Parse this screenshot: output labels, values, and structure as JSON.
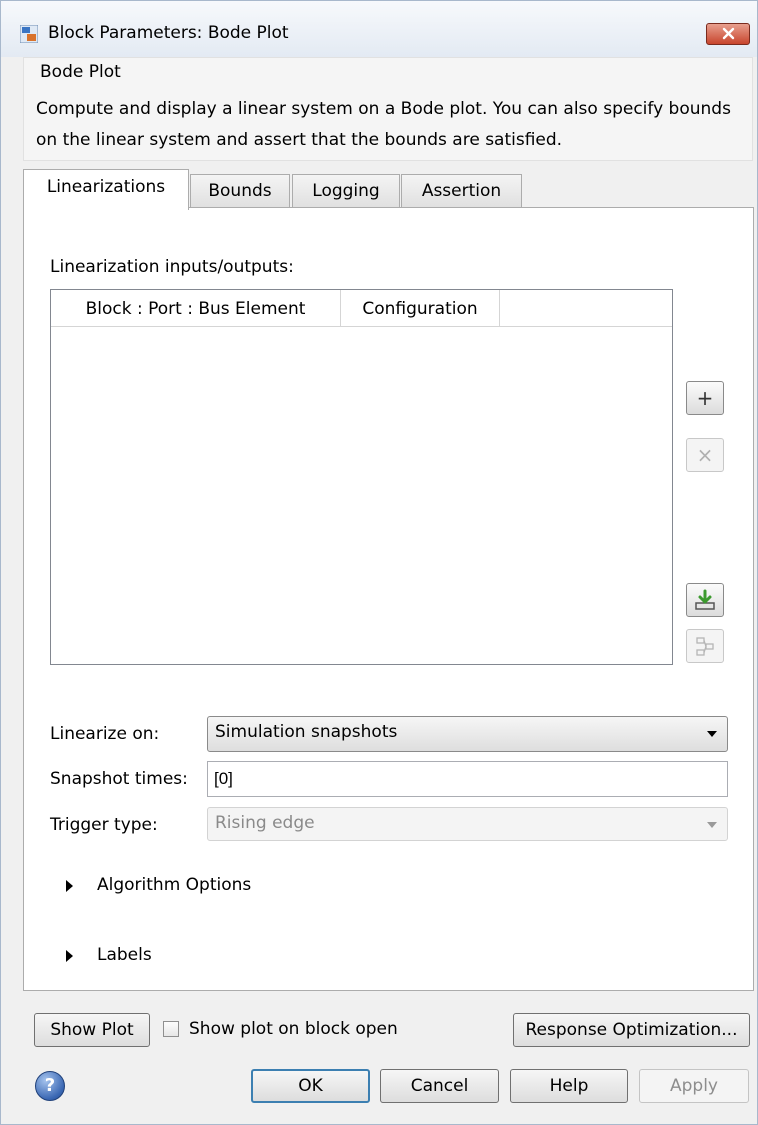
{
  "window": {
    "title": "Block Parameters: Bode Plot"
  },
  "header": {
    "title": "Bode Plot",
    "description": "Compute and display a linear system on a Bode plot. You can also specify bounds on the linear system and assert that the bounds are satisfied."
  },
  "tabs": [
    {
      "label": "Linearizations",
      "active": true
    },
    {
      "label": "Bounds",
      "active": false
    },
    {
      "label": "Logging",
      "active": false
    },
    {
      "label": "Assertion",
      "active": false
    }
  ],
  "linearizations": {
    "io_label": "Linearization inputs/outputs:",
    "table_columns": [
      "Block : Port : Bus Element",
      "Configuration"
    ],
    "table_rows": [],
    "side_buttons": [
      {
        "icon": "plus-icon",
        "glyph": "+",
        "enabled": true
      },
      {
        "icon": "delete-icon",
        "glyph": "×",
        "enabled": false
      },
      {
        "icon": "import-icon",
        "enabled": true
      },
      {
        "icon": "highlight-icon",
        "enabled": false
      }
    ],
    "linearize_on": {
      "label": "Linearize on:",
      "value": "Simulation snapshots"
    },
    "snapshot_times": {
      "label": "Snapshot times:",
      "value": "[0]"
    },
    "trigger_type": {
      "label": "Trigger type:",
      "value": "Rising edge",
      "enabled": false
    },
    "sections": [
      "Algorithm Options",
      "Labels"
    ]
  },
  "bottom": {
    "show_plot": "Show Plot",
    "show_on_open": {
      "label": "Show plot on block open",
      "checked": false
    },
    "response_optimization": "Response Optimization..."
  },
  "buttons": {
    "ok": "OK",
    "cancel": "Cancel",
    "help": "Help",
    "apply": "Apply"
  },
  "icons": {
    "help": "?"
  },
  "colors": {
    "close_button": "#c8452d",
    "default_button_border": "#3c7fb1",
    "import_icon_green": "#3c9a2e"
  }
}
